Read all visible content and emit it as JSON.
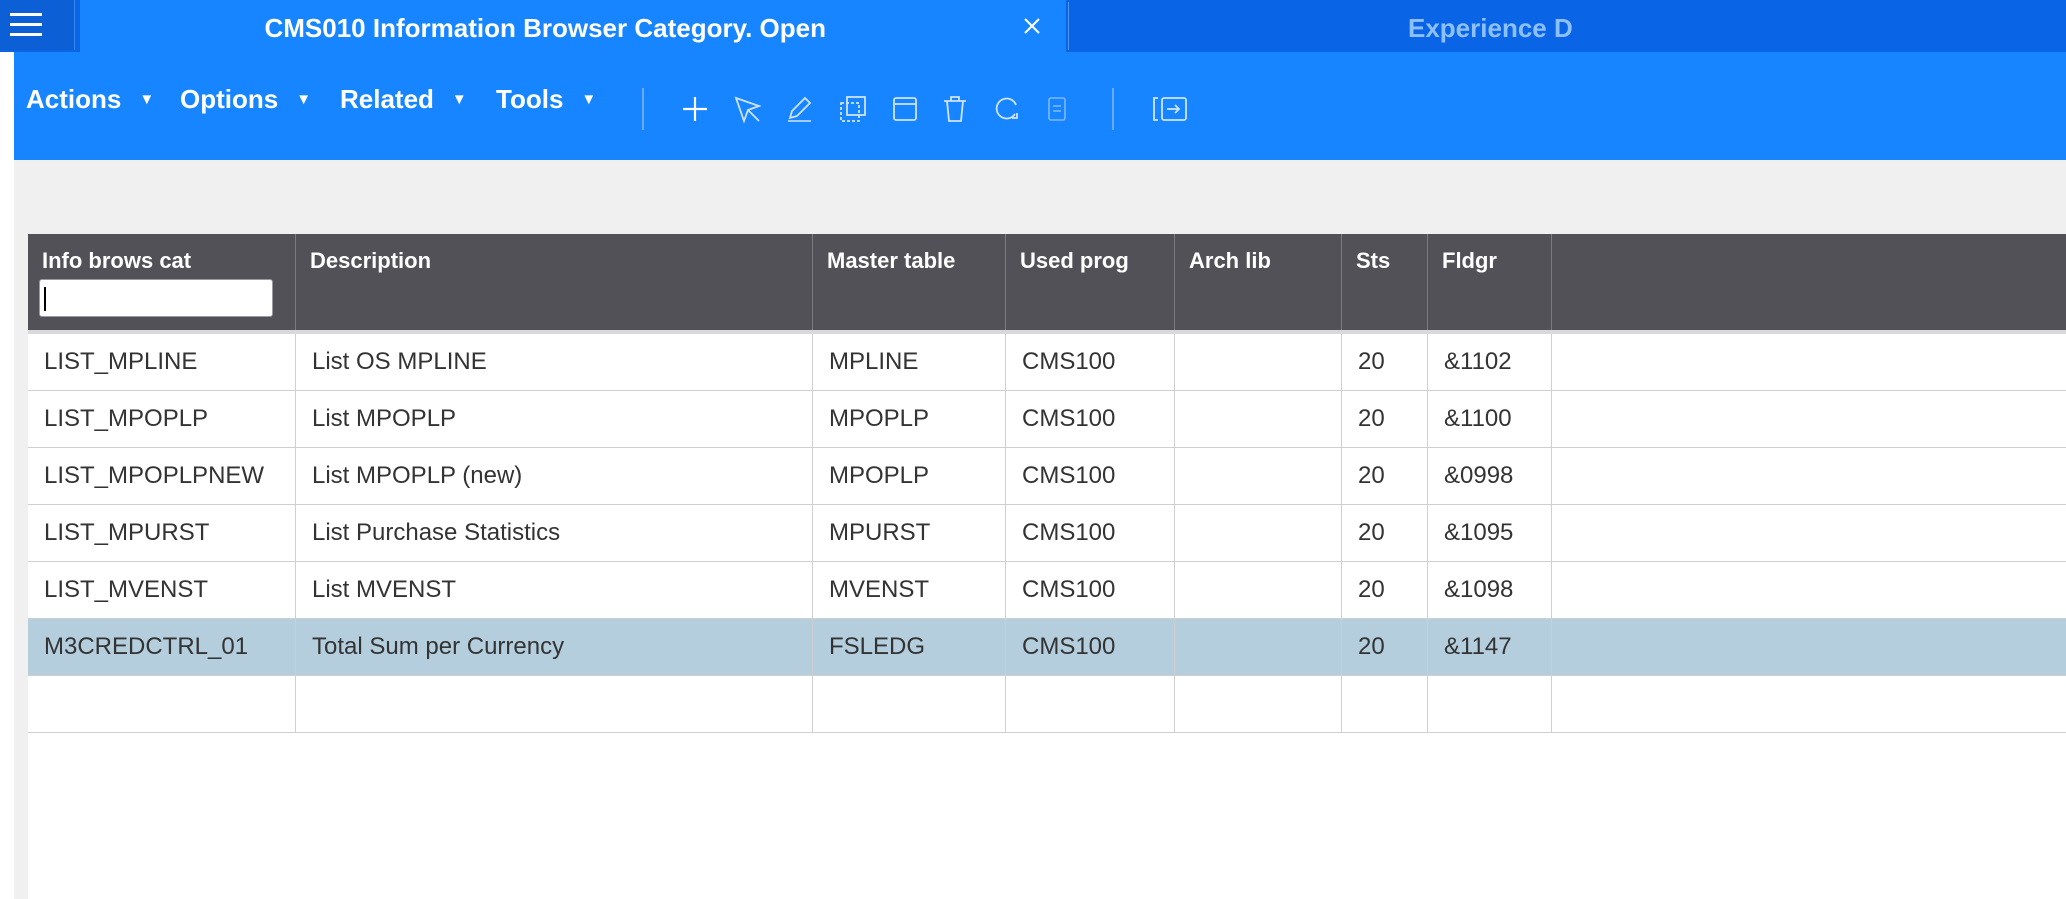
{
  "tab": {
    "title": "CMS010 Information Browser Category. Open",
    "next_tab_title": "Experience D"
  },
  "menus": {
    "actions": "Actions",
    "options": "Options",
    "related": "Related",
    "tools": "Tools"
  },
  "toolbar_icons": [
    "plus-icon",
    "select-icon",
    "edit-icon",
    "copy-icon",
    "display-icon",
    "delete-icon",
    "refresh-icon",
    "notes-icon",
    "panel-icon"
  ],
  "colors": {
    "titlebar": "#0a64e6",
    "active_tab": "#1785ff",
    "toolbar": "#1785ff",
    "header": "#525157",
    "selected_row": "#b4cede"
  },
  "grid": {
    "columns": [
      "Info brows cat",
      "Description",
      "Master table",
      "Used prog",
      "Arch lib",
      "Sts",
      "Fldgr"
    ],
    "filter_value": "",
    "rows": [
      [
        "LIST_MPLINE",
        "List OS MPLINE",
        "MPLINE",
        "CMS100",
        "",
        "20",
        "&1102"
      ],
      [
        "LIST_MPOPLP",
        "List MPOPLP",
        "MPOPLP",
        "CMS100",
        "",
        "20",
        "&1100"
      ],
      [
        "LIST_MPOPLPNEW",
        "List MPOPLP (new)",
        "MPOPLP",
        "CMS100",
        "",
        "20",
        "&0998"
      ],
      [
        "LIST_MPURST",
        "List Purchase Statistics",
        "MPURST",
        "CMS100",
        "",
        "20",
        "&1095"
      ],
      [
        "LIST_MVENST",
        "List MVENST",
        "MVENST",
        "CMS100",
        "",
        "20",
        "&1098"
      ],
      [
        "M3CREDCTRL_01",
        "Total Sum per Currency",
        "FSLEDG",
        "CMS100",
        "",
        "20",
        "&1147"
      ]
    ],
    "selected_row": 5
  }
}
